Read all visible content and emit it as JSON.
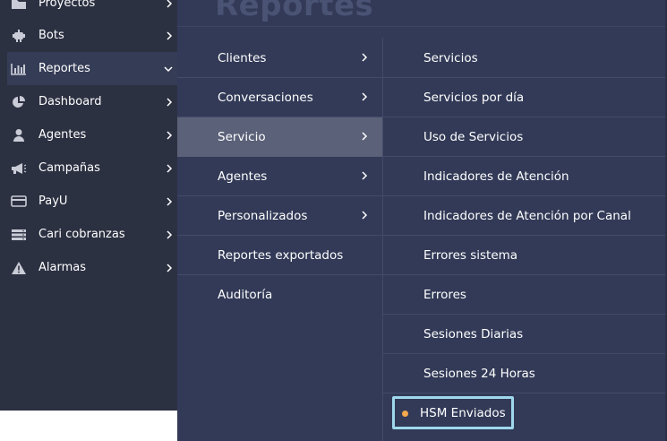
{
  "sidebar": {
    "items": [
      {
        "label": "Proyectos",
        "icon": "folder-icon"
      },
      {
        "label": "Bots",
        "icon": "bot-icon"
      },
      {
        "label": "Reportes",
        "icon": "bar-chart-icon",
        "active": true
      },
      {
        "label": "Dashboard",
        "icon": "pie-chart-icon"
      },
      {
        "label": "Agentes",
        "icon": "user-icon"
      },
      {
        "label": "Campañas",
        "icon": "megaphone-icon"
      },
      {
        "label": "PayU",
        "icon": "credit-card-icon"
      },
      {
        "label": "Cari cobranzas",
        "icon": "server-icon"
      },
      {
        "label": "Alarmas",
        "icon": "warning-icon"
      }
    ]
  },
  "menu": {
    "title": "Reportes",
    "categories": [
      {
        "label": "Clientes",
        "has_submenu": true
      },
      {
        "label": "Conversaciones",
        "has_submenu": true
      },
      {
        "label": "Servicio",
        "has_submenu": true,
        "active": true
      },
      {
        "label": "Agentes",
        "has_submenu": true
      },
      {
        "label": "Personalizados",
        "has_submenu": true
      },
      {
        "label": "Reportes exportados",
        "has_submenu": false
      },
      {
        "label": "Auditoría",
        "has_submenu": false
      }
    ],
    "submenu": [
      {
        "label": "Servicios"
      },
      {
        "label": "Servicios por día"
      },
      {
        "label": "Uso de Servicios"
      },
      {
        "label": "Indicadores de Atención"
      },
      {
        "label": "Indicadores de Atención por Canal"
      },
      {
        "label": "Errores sistema"
      },
      {
        "label": "Errores"
      },
      {
        "label": "Sesiones Diarias"
      },
      {
        "label": "Sesiones 24 Horas"
      },
      {
        "label": "HSM Enviados",
        "highlighted": true
      }
    ]
  },
  "colors": {
    "sidebar_bg": "#2c3142",
    "menu_bg": "#323a57",
    "active_category_bg": "#5a6178",
    "highlight_border": "#9fd8ec",
    "dot": "#f2a94e"
  }
}
